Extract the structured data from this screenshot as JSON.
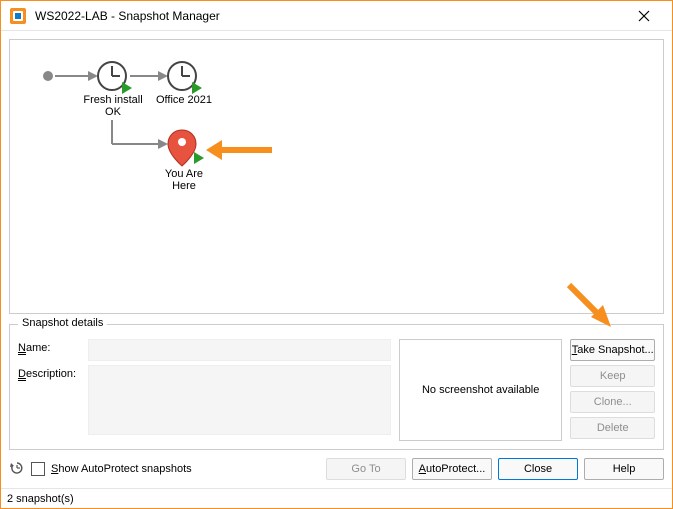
{
  "title": "WS2022-LAB - Snapshot Manager",
  "tree": {
    "snapshot1": {
      "line1": "Fresh install",
      "line2": "OK"
    },
    "snapshot2": {
      "label": "Office 2021"
    },
    "current": {
      "line1": "You Are",
      "line2": "Here"
    }
  },
  "details": {
    "legend": "Snapshot details",
    "name_label": "Name:",
    "desc_label": "Description:",
    "name_value": "",
    "desc_value": "",
    "thumb_text": "No screenshot available"
  },
  "buttons": {
    "take": "Take Snapshot...",
    "keep": "Keep",
    "clone": "Clone...",
    "delete": "Delete",
    "goto": "Go To",
    "autoprotect": "AutoProtect...",
    "close": "Close",
    "help": "Help"
  },
  "checkbox": {
    "label": "Show AutoProtect snapshots"
  },
  "status": "2 snapshot(s)"
}
